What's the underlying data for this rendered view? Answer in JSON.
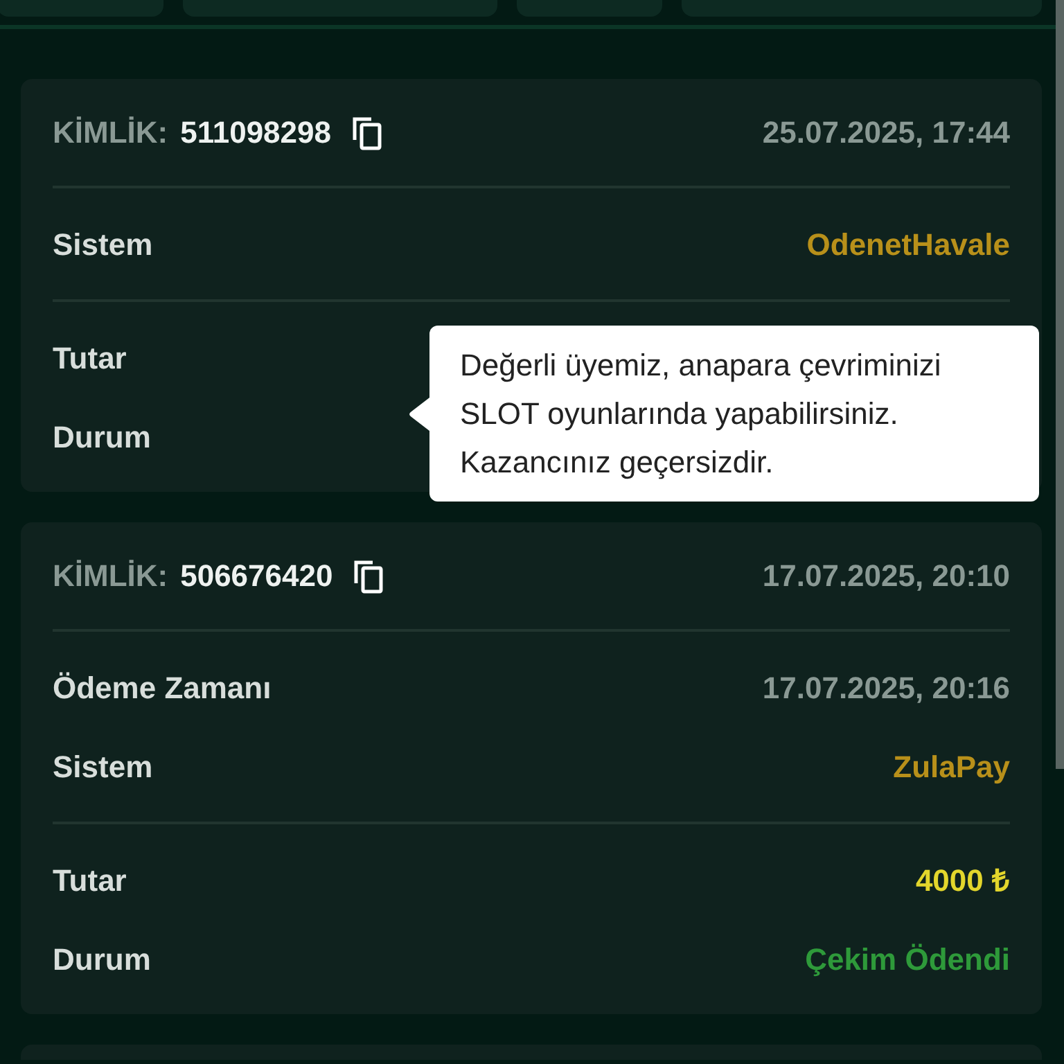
{
  "cards": [
    {
      "id_label": "KİMLİK:",
      "id": "511098298",
      "date": "25.07.2025, 17:44",
      "groups": [
        [
          {
            "label": "Sistem",
            "value": "OdenetHavale",
            "kind": "system"
          }
        ],
        [
          {
            "label": "Tutar"
          },
          {
            "label": "Durum"
          }
        ]
      ]
    },
    {
      "id_label": "KİMLİK:",
      "id": "506676420",
      "date": "17.07.2025, 20:10",
      "groups": [
        [
          {
            "label": "Ödeme Zamanı",
            "value": "17.07.2025, 20:16",
            "kind": "time"
          },
          {
            "label": "Sistem",
            "value": "ZulaPay",
            "kind": "system"
          }
        ],
        [
          {
            "label": "Tutar",
            "value": "4000 ₺",
            "kind": "amount"
          },
          {
            "label": "Durum",
            "value": "Çekim Ödendi",
            "kind": "status"
          }
        ]
      ]
    }
  ],
  "tooltip": {
    "text": "Değerli üyemiz, anapara çevriminizi SLOT oyunlarında yapabilirsiniz. Kazancınız geçersizdir."
  }
}
